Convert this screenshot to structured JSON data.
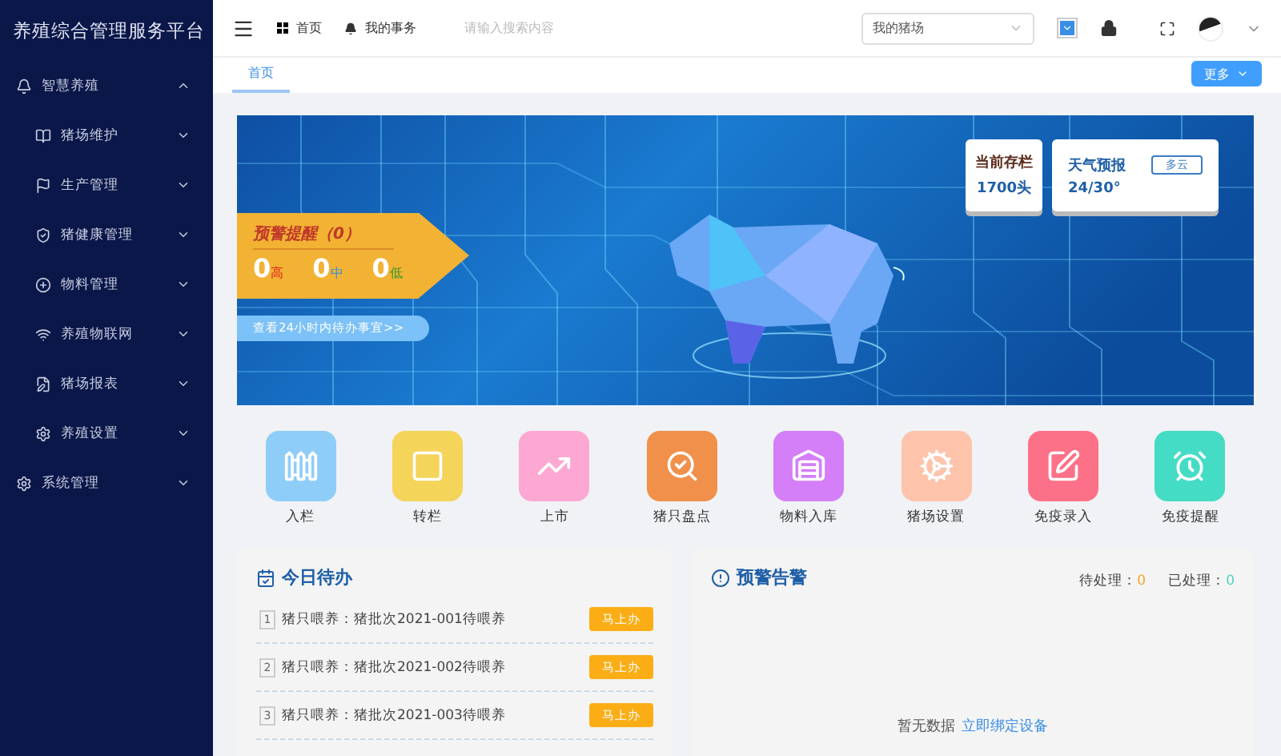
{
  "sidebar": {
    "title": "养殖综合管理服务平台",
    "items": [
      {
        "label": "智慧养殖",
        "expanded": true,
        "children": [
          {
            "label": "猪场维护",
            "expanded": false
          },
          {
            "label": "生产管理",
            "expanded": false
          },
          {
            "label": "猪健康管理",
            "expanded": false
          },
          {
            "label": "物料管理",
            "expanded": false
          },
          {
            "label": "养殖物联网",
            "expanded": false
          },
          {
            "label": "猪场报表",
            "expanded": false
          },
          {
            "label": "养殖设置",
            "expanded": false
          }
        ]
      },
      {
        "label": "系统管理",
        "expanded": false
      }
    ]
  },
  "header": {
    "nav": [
      {
        "label": "首页"
      },
      {
        "label": "我的事务"
      }
    ],
    "search": {
      "placeholder": "请输入搜索内容"
    },
    "farm_select": {
      "value": "我的猪场"
    },
    "checkbox": {
      "checked": true
    }
  },
  "tabs": [
    {
      "label": "首页",
      "selected": true
    }
  ],
  "more_button": "更多",
  "banner": {
    "alert": {
      "title": "预警提醒（0）",
      "counts": [
        {
          "value": "0",
          "label": "高",
          "color": "#e02020"
        },
        {
          "value": "0",
          "label": "中",
          "color": "#2f8fe0"
        },
        {
          "value": "0",
          "label": "低",
          "color": "#2f9a2f"
        }
      ],
      "link": "查看24小时内待办事宜>>"
    },
    "stock": {
      "label": "当前存栏",
      "value": "1700头"
    },
    "weather": {
      "label": "天气预报",
      "temperature": "24/30°",
      "condition": "多云"
    }
  },
  "quick_actions": [
    {
      "label": "入栏",
      "color": "#8fcdf9"
    },
    {
      "label": "转栏",
      "color": "#f5d45a"
    },
    {
      "label": "上市",
      "color": "#fda7d3"
    },
    {
      "label": "猪只盘点",
      "color": "#f0904a"
    },
    {
      "label": "物料入库",
      "color": "#d47ef7"
    },
    {
      "label": "猪场设置",
      "color": "#fec3ab"
    },
    {
      "label": "免疫录入",
      "color": "#fc7187"
    },
    {
      "label": "免疫提醒",
      "color": "#45dcc5"
    }
  ],
  "todo": {
    "title": "今日待办",
    "items": [
      {
        "index": "1",
        "text": "猪只喂养：猪批次2021-001待喂养",
        "button": "马上办"
      },
      {
        "index": "2",
        "text": "猪只喂养：猪批次2021-002待喂养",
        "button": "马上办"
      },
      {
        "index": "3",
        "text": "猪只喂养：猪批次2021-003待喂养",
        "button": "马上办"
      }
    ]
  },
  "alerts": {
    "title": "预警告警",
    "pending_label": "待处理：",
    "pending": "0",
    "processed_label": "已处理：",
    "processed": "0",
    "empty": "暂无数据",
    "bind_link": "立即绑定设备"
  }
}
